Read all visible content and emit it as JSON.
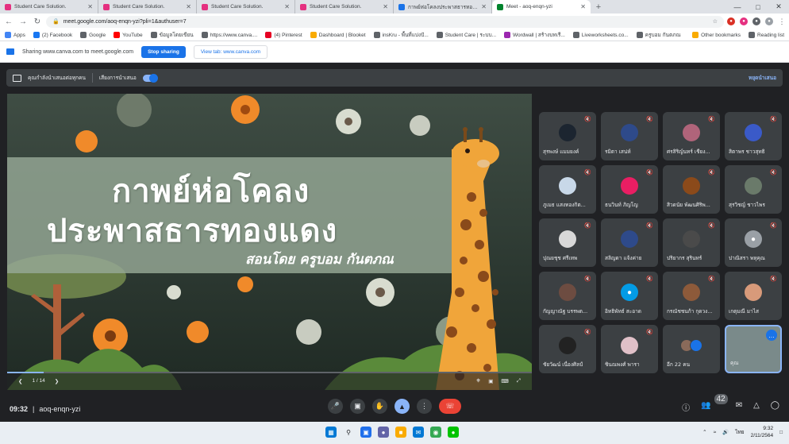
{
  "browser": {
    "tabs": [
      {
        "title": "Student Care Solution.",
        "color": "#e53080"
      },
      {
        "title": "Student Care Solution.",
        "color": "#e53080"
      },
      {
        "title": "Student Care Solution.",
        "color": "#e53080"
      },
      {
        "title": "Student Care Solution.",
        "color": "#e53080"
      },
      {
        "title": "กาพย์ห่อโคลงประพาสธารทองแดง",
        "color": "#1a73e8"
      },
      {
        "title": "Meet - aoq-enqn-yzi",
        "color": "#00832d"
      }
    ],
    "url": "meet.google.com/aoq-enqn-yzi?pli=1&authuser=7",
    "bookmarks": [
      "Apps",
      "(2) Facebook",
      "Google",
      "YouTube",
      "ข้อมูลโดยเขียน",
      "https://www.canva....",
      "(4) Pinterest",
      "Dashboard | Blooket",
      "insKru - พื้นที่แบ่งปั...",
      "Student Care | ระบบ...",
      "Wordwall | สร้างบทเรี...",
      "Liveworksheets.co...",
      "ครูบอม กันตภณ"
    ],
    "bookmarks_right": [
      "Other bookmarks",
      "Reading list"
    ]
  },
  "sharing": {
    "text": "Sharing www.canva.com to meet.google.com",
    "stop_label": "Stop sharing",
    "view_label": "View tab: www.canva.com"
  },
  "presentation": {
    "presenting_text": "คุณกำลังนำเสนอต่อทุกคน",
    "audio_label": "เสียงการนำเสนอ",
    "stop_label": "หยุดนำเสนอ"
  },
  "slide": {
    "title_line1": "กาพย์ห่อโคลง",
    "title_line2": "ประพาสธารทองแดง",
    "subtitle": "สอนโดย ครูบอม กันตภณ",
    "page": "1 / 14",
    "progress": 0.07
  },
  "participants": [
    {
      "name": "สุรพงษ์ แมมยงค์",
      "avatar": "photo",
      "color": "#1c2530"
    },
    {
      "name": "รมิตา เสน่ห์",
      "avatar": "photo",
      "color": "#2e4a8a"
    },
    {
      "name": "ศรสิริญ์นทร์ เชียง...",
      "avatar": "photo",
      "color": "#b0647a"
    },
    {
      "name": "สิตาพร ชาวสุทธิ",
      "avatar": "photo",
      "color": "#3a5ac8"
    },
    {
      "name": "ภูเมธ แสงทองกิต...",
      "avatar": "photo",
      "color": "#c8d8e8"
    },
    {
      "name": "ธนวินท์ ภิญโญ",
      "avatar": "photo",
      "color": "#e91e63"
    },
    {
      "name": "สิวดนัย พัฒนศิริพ...",
      "avatar": "photo",
      "color": "#8b4a1a"
    },
    {
      "name": "สุรวิชญ์ ชาวไพร",
      "avatar": "photo",
      "color": "#6a7a6a"
    },
    {
      "name": "ปุณยชุช ศรีเทพ",
      "avatar": "photo",
      "color": "#d8d8d8"
    },
    {
      "name": "สลิญดา แจ้งค่าย",
      "avatar": "photo",
      "color": "#2e4a8a"
    },
    {
      "name": "ปริยากร สุรินทร์",
      "avatar": "photo",
      "color": "#4a4a4a"
    },
    {
      "name": "ปาณิสรา พหุคุณ",
      "avatar": "default",
      "color": "#9aa0a6"
    },
    {
      "name": "กัญญาณัฐ บรรพต...",
      "avatar": "photo",
      "color": "#6d4c41"
    },
    {
      "name": "อิทธิพัทธ์ สะอาด",
      "avatar": "default",
      "color": "#039be5"
    },
    {
      "name": "กรณัชชนก้า กุดวง...",
      "avatar": "photo",
      "color": "#8d5a3a"
    },
    {
      "name": "เกตุมณี มาไส",
      "avatar": "photo",
      "color": "#d89a7a"
    },
    {
      "name": "ชัยวัฒน์ เนื่องศิลป์",
      "avatar": "photo",
      "color": "#222222"
    },
    {
      "name": "ชินณพงศ์ พารา",
      "avatar": "photo",
      "color": "#e0c0c8"
    }
  ],
  "more_tile": {
    "label": "อีก 22 คน"
  },
  "self_tile": {
    "label": "คุณ"
  },
  "meeting": {
    "time": "09:32",
    "code": "aoq-enqn-yzi",
    "people_count": "42"
  },
  "taskbar": {
    "time": "9:32",
    "date": "2/11/2564",
    "lang": "ไทย"
  },
  "colors": {
    "meet_bg": "#202124",
    "accent": "#8ab4f8",
    "end_call": "#ea4335",
    "share_blue": "#1a73e8"
  }
}
